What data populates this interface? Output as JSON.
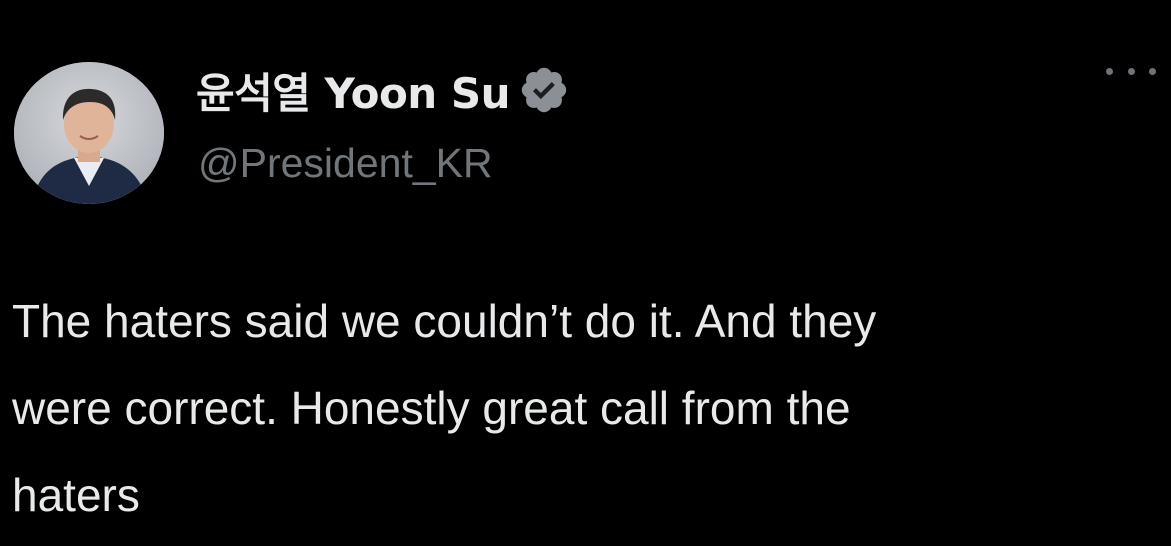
{
  "author": {
    "display_name": "윤석열 Yoon Su",
    "handle": "@President_KR",
    "verified": true
  },
  "tweet": {
    "text": "The haters said we couldn’t do it. And they\nwere correct. Honestly great call from the\nhaters"
  },
  "icons": {
    "verified": "verified-badge-icon",
    "more": "more-horizontal-icon"
  },
  "colors": {
    "background": "#000000",
    "text_primary": "#e7e9ea",
    "text_secondary": "#71767b",
    "verified_badge": "#8b9096"
  }
}
